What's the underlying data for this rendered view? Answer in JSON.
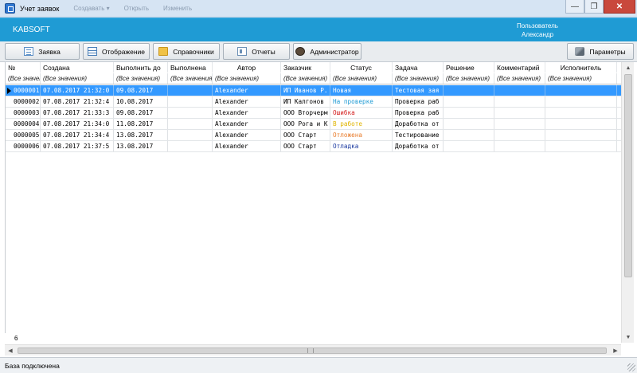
{
  "window": {
    "title": "Учет заявок",
    "menu_ghost": [
      "Создавать ▾",
      "Открыть",
      "Изменить"
    ],
    "controls": [
      "—",
      "❐",
      "✕"
    ]
  },
  "header": {
    "brand": "KABSOFT",
    "user_label": "Пользователь",
    "user_name": "Александр"
  },
  "toolbar": {
    "request": "Заявка",
    "display": "Отображение",
    "directories": "Справочники",
    "reports": "Отчеты",
    "admin": "Администратор",
    "params": "Параметры"
  },
  "columns": [
    "№",
    "Создана",
    "Выполнить до",
    "Выполнена",
    "Автор",
    "Заказчик",
    "Статус",
    "Задача",
    "Решение",
    "Комментарий",
    "Исполнитель"
  ],
  "filters": [
    "(Все значения)",
    "(Все значения)",
    "(Все значения)",
    "(Все значения)",
    "(Все значения)",
    "(Все значения)",
    "(Все значения)",
    "(Все значения)",
    "(Все значения)",
    "(Все значения)",
    "(Все значения)"
  ],
  "rows": [
    {
      "num": "0000001",
      "created": "07.08.2017 21:32:0",
      "due": "09.08.2017",
      "done": "",
      "author": "Alexander",
      "customer": "ИП Иванов Р.",
      "status": "Новая",
      "status_color": "#2e7fd0",
      "task": "Тестовая зая",
      "solution": "",
      "comment": "",
      "executor": ""
    },
    {
      "num": "0000002",
      "created": "07.08.2017 21:32:4",
      "due": "10.08.2017",
      "done": "",
      "author": "Alexander",
      "customer": "ИП Калгонов",
      "status": "На проверке",
      "status_color": "#1f9bd4",
      "task": "Проверка раб",
      "solution": "",
      "comment": "",
      "executor": ""
    },
    {
      "num": "0000003",
      "created": "07.08.2017 21:33:3",
      "due": "09.08.2017",
      "done": "",
      "author": "Alexander",
      "customer": "ООО Вторчерм",
      "status": "Ошибка",
      "status_color": "#d42020",
      "task": "Проверка раб",
      "solution": "",
      "comment": "",
      "executor": ""
    },
    {
      "num": "0000004",
      "created": "07.08.2017 21:34:0",
      "due": "11.08.2017",
      "done": "",
      "author": "Alexander",
      "customer": "ООО Рога и К",
      "status": "В работе",
      "status_color": "#e0b400",
      "task": "Доработка от",
      "solution": "",
      "comment": "",
      "executor": ""
    },
    {
      "num": "0000005",
      "created": "07.08.2017 21:34:4",
      "due": "13.08.2017",
      "done": "",
      "author": "Alexander",
      "customer": "ООО Старт",
      "status": "Отложена",
      "status_color": "#e87b2a",
      "task": "Тестирование",
      "solution": "",
      "comment": "",
      "executor": ""
    },
    {
      "num": "0000006",
      "created": "07.08.2017 21:37:5",
      "due": "13.08.2017",
      "done": "",
      "author": "Alexander",
      "customer": "ООО Старт",
      "status": "Отладка",
      "status_color": "#1c3aa0",
      "task": "Доработка от",
      "solution": "",
      "comment": "",
      "executor": ""
    }
  ],
  "selected_row": 0,
  "row_count": "6",
  "status_bar": "База подключена",
  "colors": {
    "header_bg": "#1f9bd4",
    "selection": "#3399ff"
  }
}
